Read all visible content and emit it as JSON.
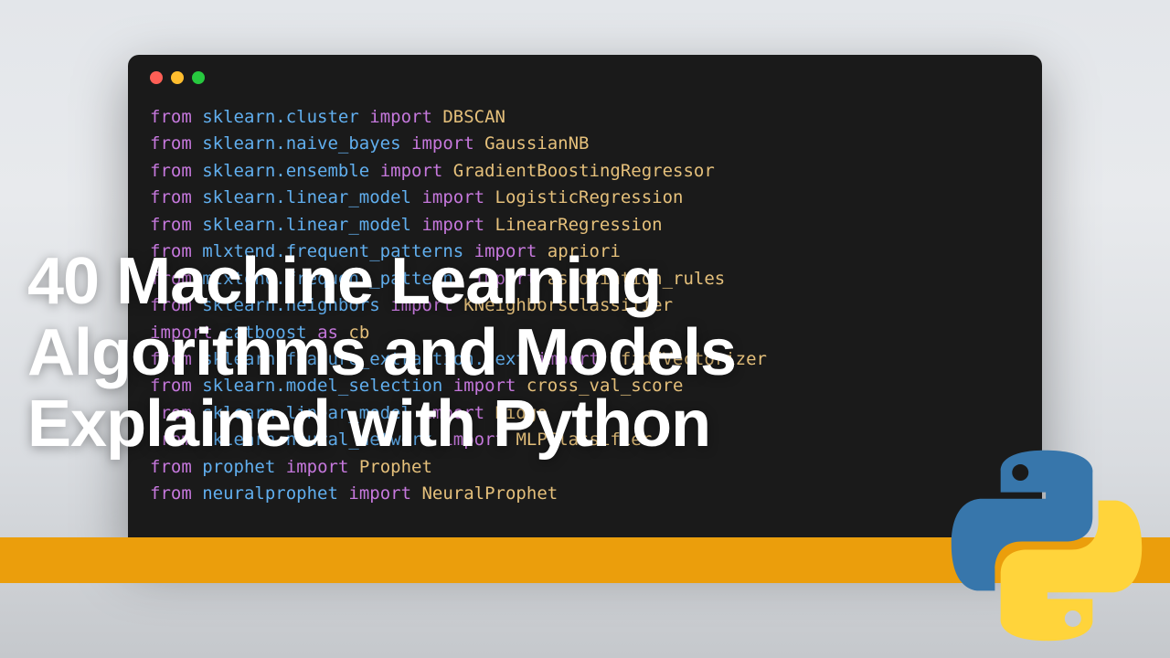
{
  "headline": "40 Machine Learning\nAlgorithms and Models\nExplained with Python",
  "code_lines": [
    {
      "kw1": "from",
      "mod": "sklearn.cluster",
      "kw2": "import",
      "cls": "DBSCAN"
    },
    {
      "kw1": "from",
      "mod": "sklearn.naive_bayes",
      "kw2": "import",
      "cls": "GaussianNB"
    },
    {
      "kw1": "from",
      "mod": "sklearn.ensemble",
      "kw2": "import",
      "cls": "GradientBoostingRegressor"
    },
    {
      "kw1": "from",
      "mod": "sklearn.linear_model",
      "kw2": "import",
      "cls": "LogisticRegression"
    },
    {
      "kw1": "from",
      "mod": "sklearn.linear_model",
      "kw2": "import",
      "cls": "LinearRegression"
    },
    {
      "kw1": "from",
      "mod": "mlxtend.frequent_patterns",
      "kw2": "import",
      "cls": "apriori"
    },
    {
      "kw1": "from",
      "mod": "mlxtend.frequent_patterns",
      "kw2": "import",
      "cls": "association_rules"
    },
    {
      "kw1": "from",
      "mod": "sklearn.neighbors",
      "kw2": "import",
      "cls": "KNeighborsClassifier"
    },
    {
      "kw1": "import",
      "mod": "catboost",
      "kw2": "as",
      "cls": "cb"
    },
    {
      "kw1": "from",
      "mod": "sklearn.feature_extraction.text",
      "kw2": "import",
      "cls": "TfidfVectorizer"
    },
    {
      "kw1": "from",
      "mod": "sklearn.model_selection",
      "kw2": "import",
      "cls": "cross_val_score"
    },
    {
      "kw1": "from",
      "mod": "sklearn.linear_model",
      "kw2": "import",
      "cls": "Ridge"
    },
    {
      "kw1": "from",
      "mod": "sklearn.neural_network",
      "kw2": "import",
      "cls": "MLPClassifier"
    },
    {
      "kw1": "from",
      "mod": "prophet",
      "kw2": "import",
      "cls": "Prophet"
    },
    {
      "kw1": "from",
      "mod": "neuralprophet",
      "kw2": "import",
      "cls": "NeuralProphet"
    }
  ],
  "colors": {
    "stripe": "#eb9e0c",
    "python_blue": "#3776ab",
    "python_yellow": "#ffd43b"
  }
}
